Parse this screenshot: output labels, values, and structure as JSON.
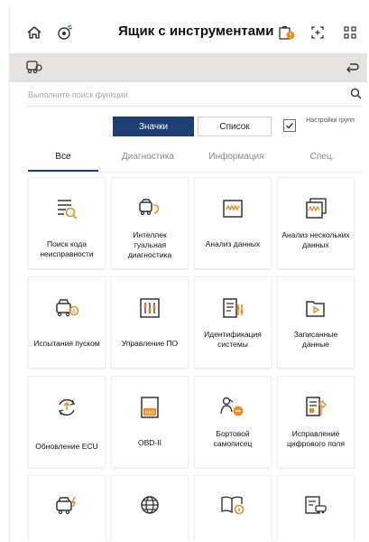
{
  "header": {
    "title": "Ящик с инструментами",
    "icons": [
      "home-icon",
      "vci-link-icon",
      "battery-icon",
      "screenshot-icon",
      "apps-grid-icon"
    ]
  },
  "vehicle_bar": {
    "icons": [
      "vehicle-icon",
      "back-icon"
    ]
  },
  "search": {
    "placeholder": "Выполните поиск функции"
  },
  "view_toggle": {
    "icons_label": "Значки",
    "list_label": "Список",
    "group_settings_label": "Настройки групп",
    "group_settings_checked": true
  },
  "tabs": [
    {
      "label": "Все",
      "active": true
    },
    {
      "label": "Диагностика",
      "active": false
    },
    {
      "label": "Информация",
      "active": false
    },
    {
      "label": "Спец.",
      "active": false
    }
  ],
  "tiles": [
    {
      "label": "Поиск кода неисправности",
      "icon": "fault-code-search-icon"
    },
    {
      "label": "Интеллек туальная диагностика",
      "icon": "smart-diagnosis-icon"
    },
    {
      "label": "Анализ данных",
      "icon": "data-analysis-icon"
    },
    {
      "label": "Анализ нескольких данных",
      "icon": "multi-data-analysis-icon"
    },
    {
      "label": "Испытания пуском",
      "icon": "start-test-icon"
    },
    {
      "label": "Управление ПО",
      "icon": "software-management-icon"
    },
    {
      "label": "Идентификация системы",
      "icon": "system-identification-icon"
    },
    {
      "label": "Записанные данные",
      "icon": "recorded-data-icon"
    },
    {
      "label": "Обновление ECU",
      "icon": "ecu-update-icon"
    },
    {
      "label": "OBD-II",
      "icon": "obd-ii-icon"
    },
    {
      "label": "Бортовой самописец",
      "icon": "flight-recorder-icon"
    },
    {
      "label": "Исправление цифрового поля",
      "icon": "digital-field-repair-icon"
    },
    {
      "label": "",
      "icon": "vehicle-charge-icon"
    },
    {
      "label": "",
      "icon": "globe-icon"
    },
    {
      "label": "",
      "icon": "manual-info-icon"
    },
    {
      "label": "",
      "icon": "vehicle-list-icon"
    }
  ],
  "colors": {
    "accent": "#1d3f73",
    "icon_orange": "#f08a1e",
    "vehicle_bar": "#e5e2df"
  }
}
